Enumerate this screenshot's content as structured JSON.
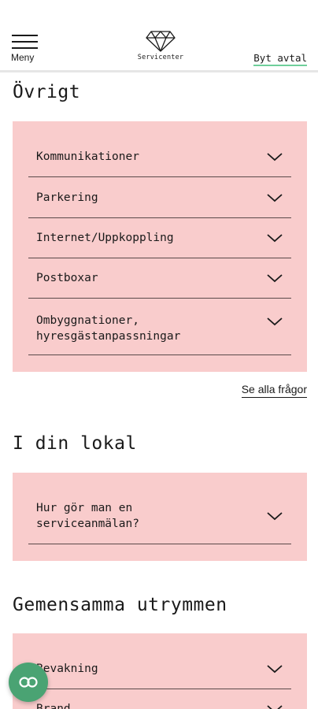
{
  "header": {
    "menu_label": "Meny",
    "logo_text": "Servicenter",
    "switch_agreement": "Byt avtal"
  },
  "sections": [
    {
      "title": "Övrigt",
      "items": [
        {
          "label": "Kommunikationer"
        },
        {
          "label": "Parkering"
        },
        {
          "label": "Internet/Uppkoppling"
        },
        {
          "label": "Postboxar"
        },
        {
          "label": "Ombyggnationer,\nhyresgästanpassningar"
        }
      ]
    },
    {
      "title": "I din lokal",
      "items": [
        {
          "label": "Hur gör man en\nserviceanmälan?"
        }
      ]
    },
    {
      "title": "Gemensamma utrymmen",
      "items": [
        {
          "label": "Bevakning"
        },
        {
          "label": "Brand"
        }
      ]
    }
  ],
  "see_all": "Se alla frågor",
  "icons": {
    "menu": "hamburger-icon",
    "logo": "diamond-icon",
    "expand": "chevron-down-icon",
    "chat": "chat-icon"
  },
  "colors": {
    "card_bg": "#f9cccc",
    "accent_green": "#4aa373",
    "underline_green": "#6fcf9b"
  }
}
